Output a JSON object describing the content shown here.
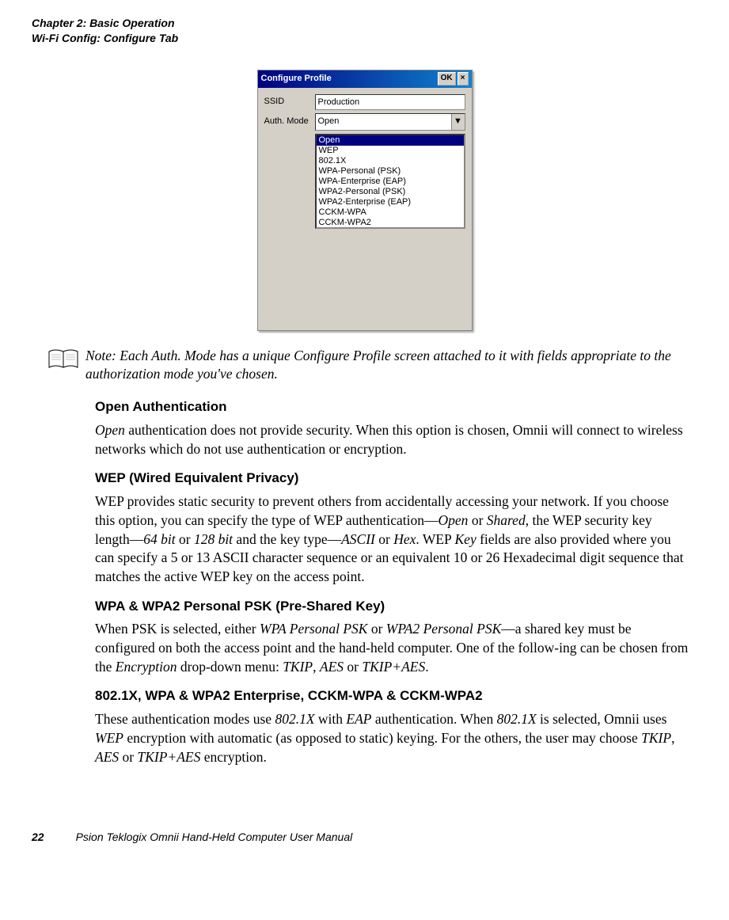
{
  "header": {
    "chapter_line": "Chapter 2:  Basic Operation",
    "section_line": "Wi-Fi Config: Configure Tab"
  },
  "dialog": {
    "title": "Configure Profile",
    "ok_label": "OK",
    "close_glyph": "×",
    "ssid_label": "SSID",
    "ssid_value": "Production",
    "auth_label": "Auth. Mode",
    "auth_value": "Open",
    "dropdown_glyph": "▼",
    "options": [
      "Open",
      "WEP",
      "802.1X",
      "WPA-Personal (PSK)",
      "WPA-Enterprise (EAP)",
      "WPA2-Personal (PSK)",
      "WPA2-Enterprise (EAP)",
      "CCKM-WPA",
      "CCKM-WPA2"
    ]
  },
  "note": {
    "label": "Note:",
    "text": "Each Auth. Mode has a unique Configure Profile screen attached to it with fields appropriate to the authorization mode you've chosen."
  },
  "sections": {
    "open": {
      "title": "Open Authentication",
      "body_html": "<i>Open</i> authentication does not provide security. When this option is chosen, Omnii will connect to wireless networks which do not use authentication or encryption."
    },
    "wep": {
      "title": "WEP (Wired Equivalent Privacy)",
      "body_html": "WEP provides static security to prevent others from accidentally accessing your network. If you choose this option, you can specify the type of WEP authentication—<i>Open</i> or <i>Shared</i>, the WEP security key length—<i>64 bit</i> or <i>128 bit</i> and the key type—<i>ASCII</i> or <i>Hex</i>. WEP <i>Key</i> fields are also provided where you can specify a 5 or 13 ASCII character sequence or an equivalent 10 or 26 Hexadecimal digit sequence that matches the active WEP key on the access point."
    },
    "psk": {
      "title": "WPA & WPA2 Personal PSK (Pre-Shared Key)",
      "body_html": "When PSK is selected, either <i>WPA Personal PSK</i> or <i>WPA2 Personal PSK</i>—a shared key must be configured on both the access point and the hand-held computer. One of the follow-ing can be chosen from the <i>Encryption</i> drop-down menu: <i>TKIP</i>, <i>AES</i> or <i>TKIP+AES</i>."
    },
    "enterprise": {
      "title": "802.1X, WPA & WPA2 Enterprise, CCKM-WPA & CCKM-WPA2",
      "body_html": "These authentication modes use <i>802.1X</i> with <i>EAP</i> authentication. When <i>802.1X</i> is selected, Omnii uses <i>WEP</i> encryption with automatic (as opposed to static) keying. For the others, the user may choose <i>TKIP</i>, <i>AES</i> or <i>TKIP+AES</i> encryption."
    }
  },
  "footer": {
    "page": "22",
    "title": "Psion Teklogix Omnii Hand-Held Computer User Manual"
  }
}
